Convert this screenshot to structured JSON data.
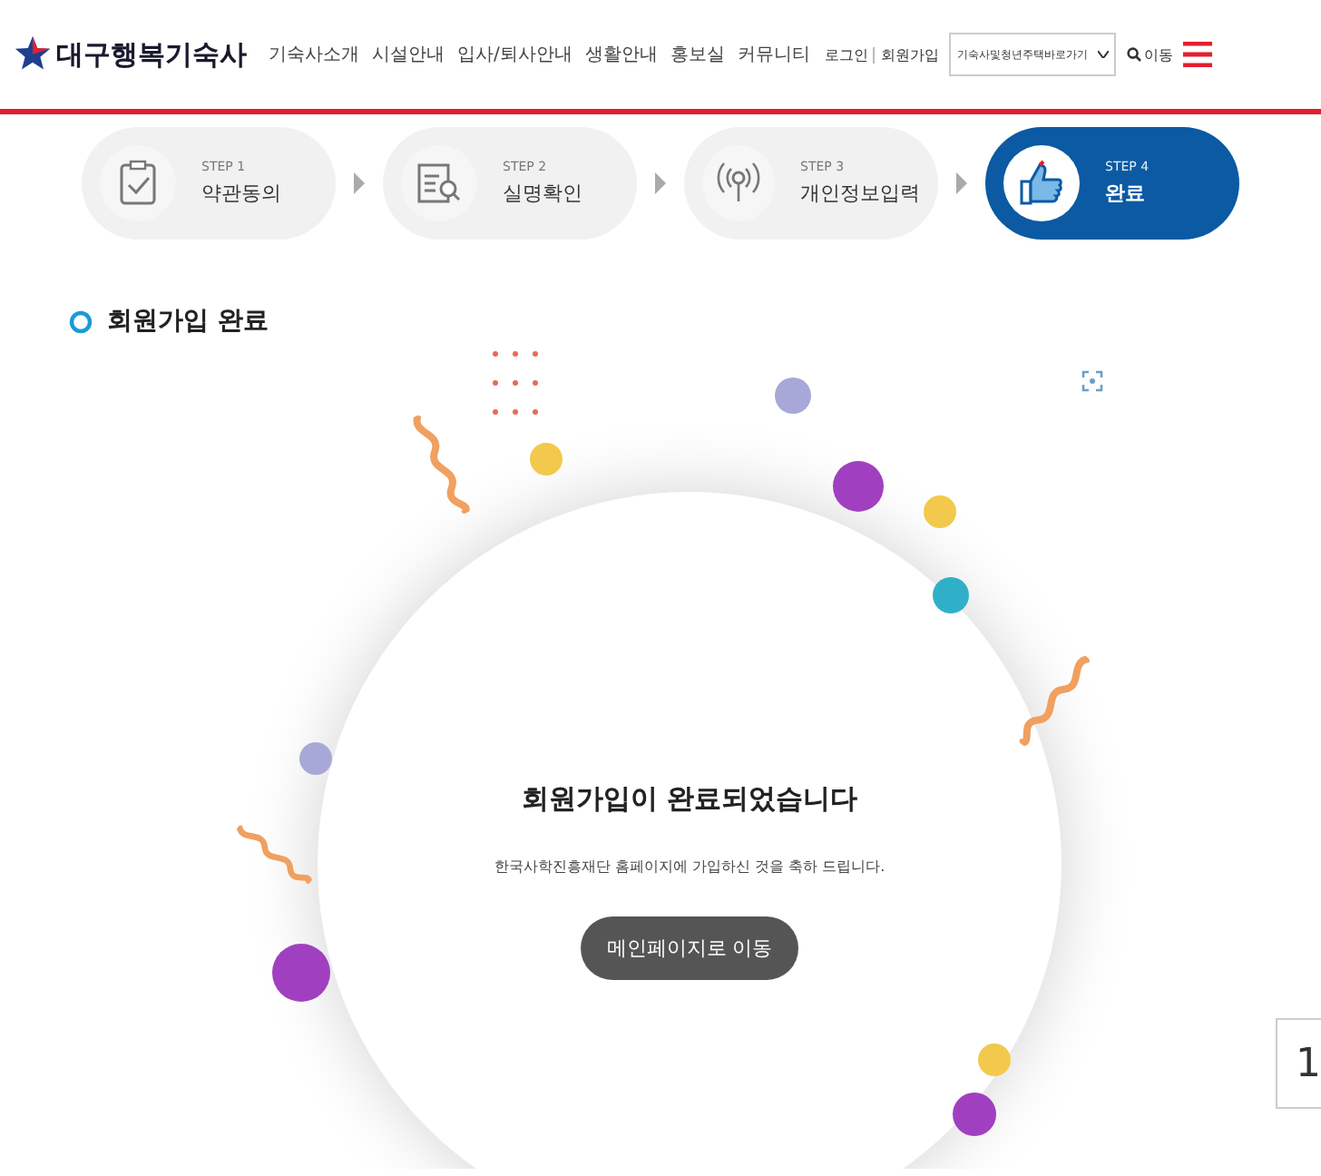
{
  "header": {
    "logo": "대구행복기숙사",
    "nav": [
      "기숙사소개",
      "시설안내",
      "입사/퇴사안내",
      "생활안내",
      "홍보실",
      "커뮤니티"
    ],
    "utility_links": [
      "로그인",
      "회원가입"
    ],
    "shortcut_select": {
      "value": "기숙사및청년주택바로가기"
    },
    "go_button": "이동"
  },
  "steps": [
    {
      "step": "STEP 1",
      "label": "약관동의",
      "kind": "clipboard",
      "selected": false
    },
    {
      "step": "STEP 2",
      "label": "실명확인",
      "kind": "document",
      "selected": false
    },
    {
      "step": "STEP 3",
      "label": "개인정보입력",
      "kind": "signal",
      "selected": false
    },
    {
      "step": "STEP 4",
      "label": "완료",
      "kind": "thumb",
      "selected": true
    }
  ],
  "section_title": "회원가입 완료",
  "completion": {
    "heading": "회원가입이 완료되었습니다",
    "message": "한국사학진흥재단 홈페이지에 가입하신 것을 축하 드립니다.",
    "button": "메인페이지로 이동"
  },
  "side_widget": "1"
}
